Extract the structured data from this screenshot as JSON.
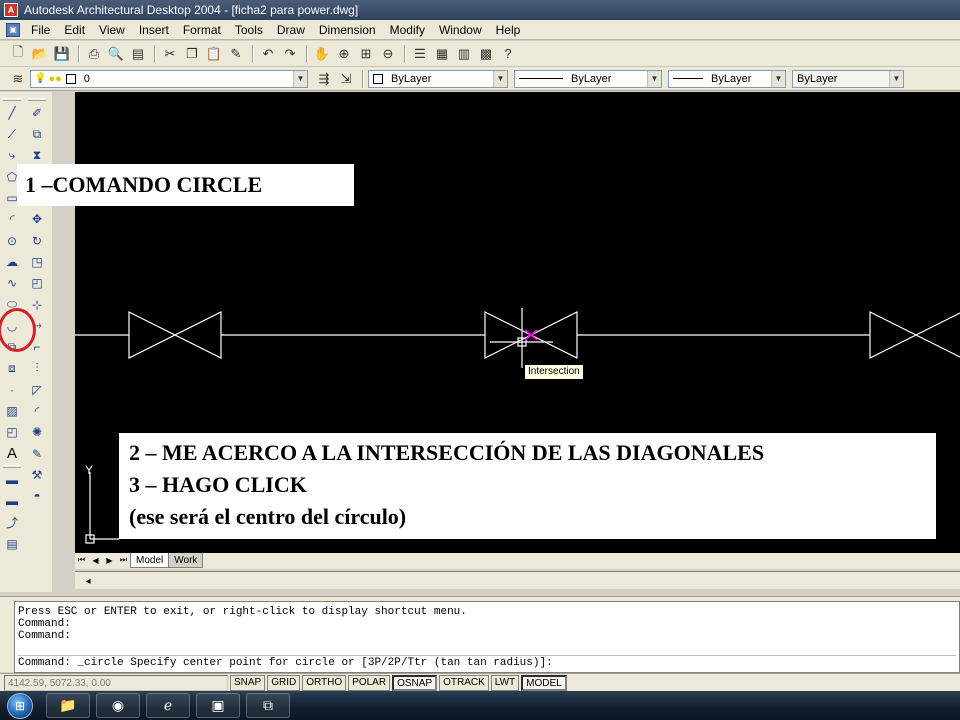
{
  "window": {
    "title": "Autodesk Architectural Desktop 2004 - [ficha2 para power.dwg]",
    "app_icon": "A"
  },
  "menu": [
    "File",
    "Edit",
    "View",
    "Insert",
    "Format",
    "Tools",
    "Draw",
    "Dimension",
    "Modify",
    "Window",
    "Help"
  ],
  "layers": {
    "current_layer": "0",
    "color": "ByLayer",
    "linetype": "ByLayer",
    "lineweight": "ByLayer",
    "plotstyle": "ByLayer"
  },
  "tooltip": {
    "text": "Intersection"
  },
  "annotations": {
    "step1": "1 –COMANDO CIRCLE",
    "step2": "2 – ME ACERCO A LA INTERSECCIÓN DE LAS DIAGONALES",
    "step3": "3 – HAGO CLICK",
    "step3_note": "(ese será el centro del círculo)"
  },
  "ucs": {
    "y_label": "Y"
  },
  "tabs": {
    "model": "Model",
    "work": "Work"
  },
  "command": {
    "lines": [
      "Press ESC or ENTER to exit, or right-click to display shortcut menu.",
      "Command:",
      "Command:"
    ],
    "prompt": "Command: _circle Specify center point for circle or [3P/2P/Ttr (tan tan radius)]:"
  },
  "status": {
    "coords": "4142.59, 5072.33, 0.00",
    "buttons": [
      "SNAP",
      "GRID",
      "ORTHO",
      "POLAR",
      "OSNAP",
      "OTRACK",
      "LWT",
      "MODEL"
    ],
    "active": [
      "OSNAP",
      "MODEL"
    ]
  },
  "colors": {
    "canvas": "#000000",
    "geometry": "#ffffff",
    "snap_marker": "#ff00ff",
    "highlight_circle": "#d2232a",
    "chrome": "#ece9d8"
  },
  "icons": {
    "toolbar_standard": [
      "new-icon",
      "open-icon",
      "save-icon",
      "print-icon",
      "preview-icon",
      "publish-icon",
      "cut-icon",
      "copy-icon",
      "paste-icon",
      "matchprop-icon",
      "undo-icon",
      "redo-icon",
      "pan-icon",
      "zoom-realtime-icon",
      "zoom-window-icon",
      "zoom-previous-icon",
      "properties-icon",
      "designcenter-icon",
      "toolpalettes-icon",
      "help-icon"
    ],
    "toolbar_layers": [
      "layer-manager-icon",
      "layer-state-icon",
      "make-current-icon"
    ],
    "draw_tools": [
      "line-icon",
      "xline-icon",
      "polyline-icon",
      "polygon-icon",
      "rectangle-icon",
      "arc-icon",
      "circle-icon",
      "revcloud-icon",
      "spline-icon",
      "ellipse-icon",
      "ellipse-arc-icon",
      "insert-block-icon",
      "make-block-icon",
      "point-icon",
      "hatch-icon",
      "region-icon",
      "mtext-icon"
    ],
    "modify_tools": [
      "erase-icon",
      "copy-object-icon",
      "mirror-icon",
      "offset-icon",
      "array-icon",
      "move-icon",
      "rotate-icon",
      "scale-icon",
      "stretch-icon",
      "trim-icon",
      "extend-icon",
      "break-icon",
      "join-icon",
      "chamfer-icon",
      "fillet-icon",
      "explode-icon"
    ],
    "taskbar": [
      "start-orb-icon",
      "explorer-icon",
      "media-icon",
      "ie-icon",
      "autocad-icon",
      "powerpoint-icon"
    ]
  }
}
